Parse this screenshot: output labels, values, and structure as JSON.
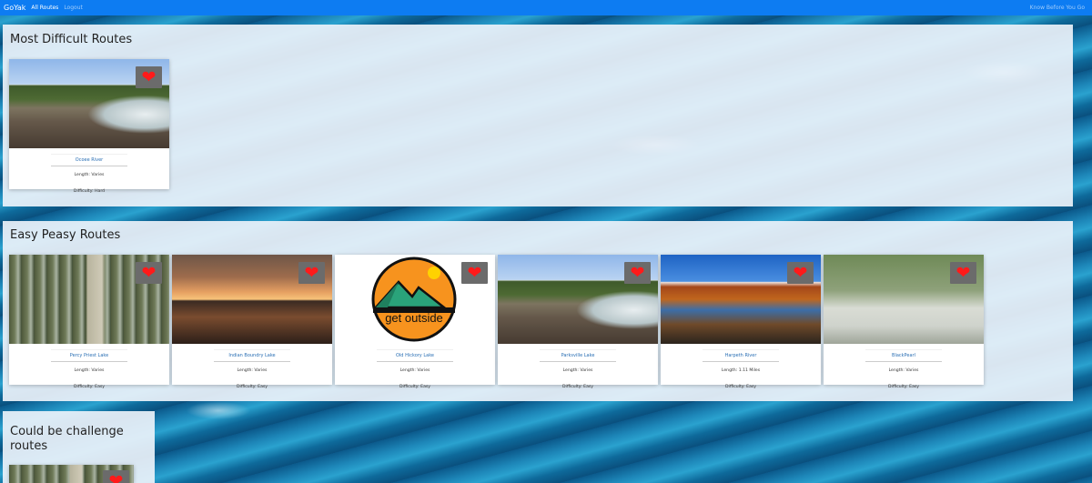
{
  "nav": {
    "brand": "GoYak",
    "links": [
      "All Routes",
      "Logout"
    ],
    "right": "Know Before You Go"
  },
  "sections": [
    {
      "title": "Most Difficult Routes",
      "cards": [
        {
          "name": "Ocoee River",
          "length": "Length: Varies",
          "difficulty": "Difficulty: Hard",
          "image": "river-rapids-photo"
        }
      ]
    },
    {
      "title": "Easy Peasy Routes",
      "cards": [
        {
          "name": "Percy Priest Lake",
          "length": "Length: Varies",
          "difficulty": "Difficulty: Easy",
          "image": "forest-path-photo"
        },
        {
          "name": "Indian Boundry Lake",
          "length": "Length: Varies",
          "difficulty": "Difficulty: Easy",
          "image": "sunset-lake-photo"
        },
        {
          "name": "Old Hickory Lake",
          "length": "Length: Varies",
          "difficulty": "Difficulty: Easy",
          "image": "get-outside-logo",
          "logo_text": "get outside"
        },
        {
          "name": "Parksville Lake",
          "length": "Length: Varies",
          "difficulty": "Difficulty: Easy",
          "image": "river-rapids-photo"
        },
        {
          "name": "Harpeth River",
          "length": "Length: 1.11 Miles",
          "difficulty": "Difficulty: Easy",
          "image": "autumn-river-photo"
        },
        {
          "name": "BlackPearl",
          "length": "Length: Varies",
          "difficulty": "Difficulty: Easy",
          "image": "foggy-river-photo"
        }
      ]
    },
    {
      "title": "Could be challenge routes",
      "cards": [
        {
          "image": "forest-path-photo"
        }
      ]
    }
  ],
  "icons": {
    "favorite": "heart-icon"
  },
  "colors": {
    "navbar": "#0d7cf2",
    "heart": "#ff1a1a",
    "link": "#2a6fb4"
  }
}
